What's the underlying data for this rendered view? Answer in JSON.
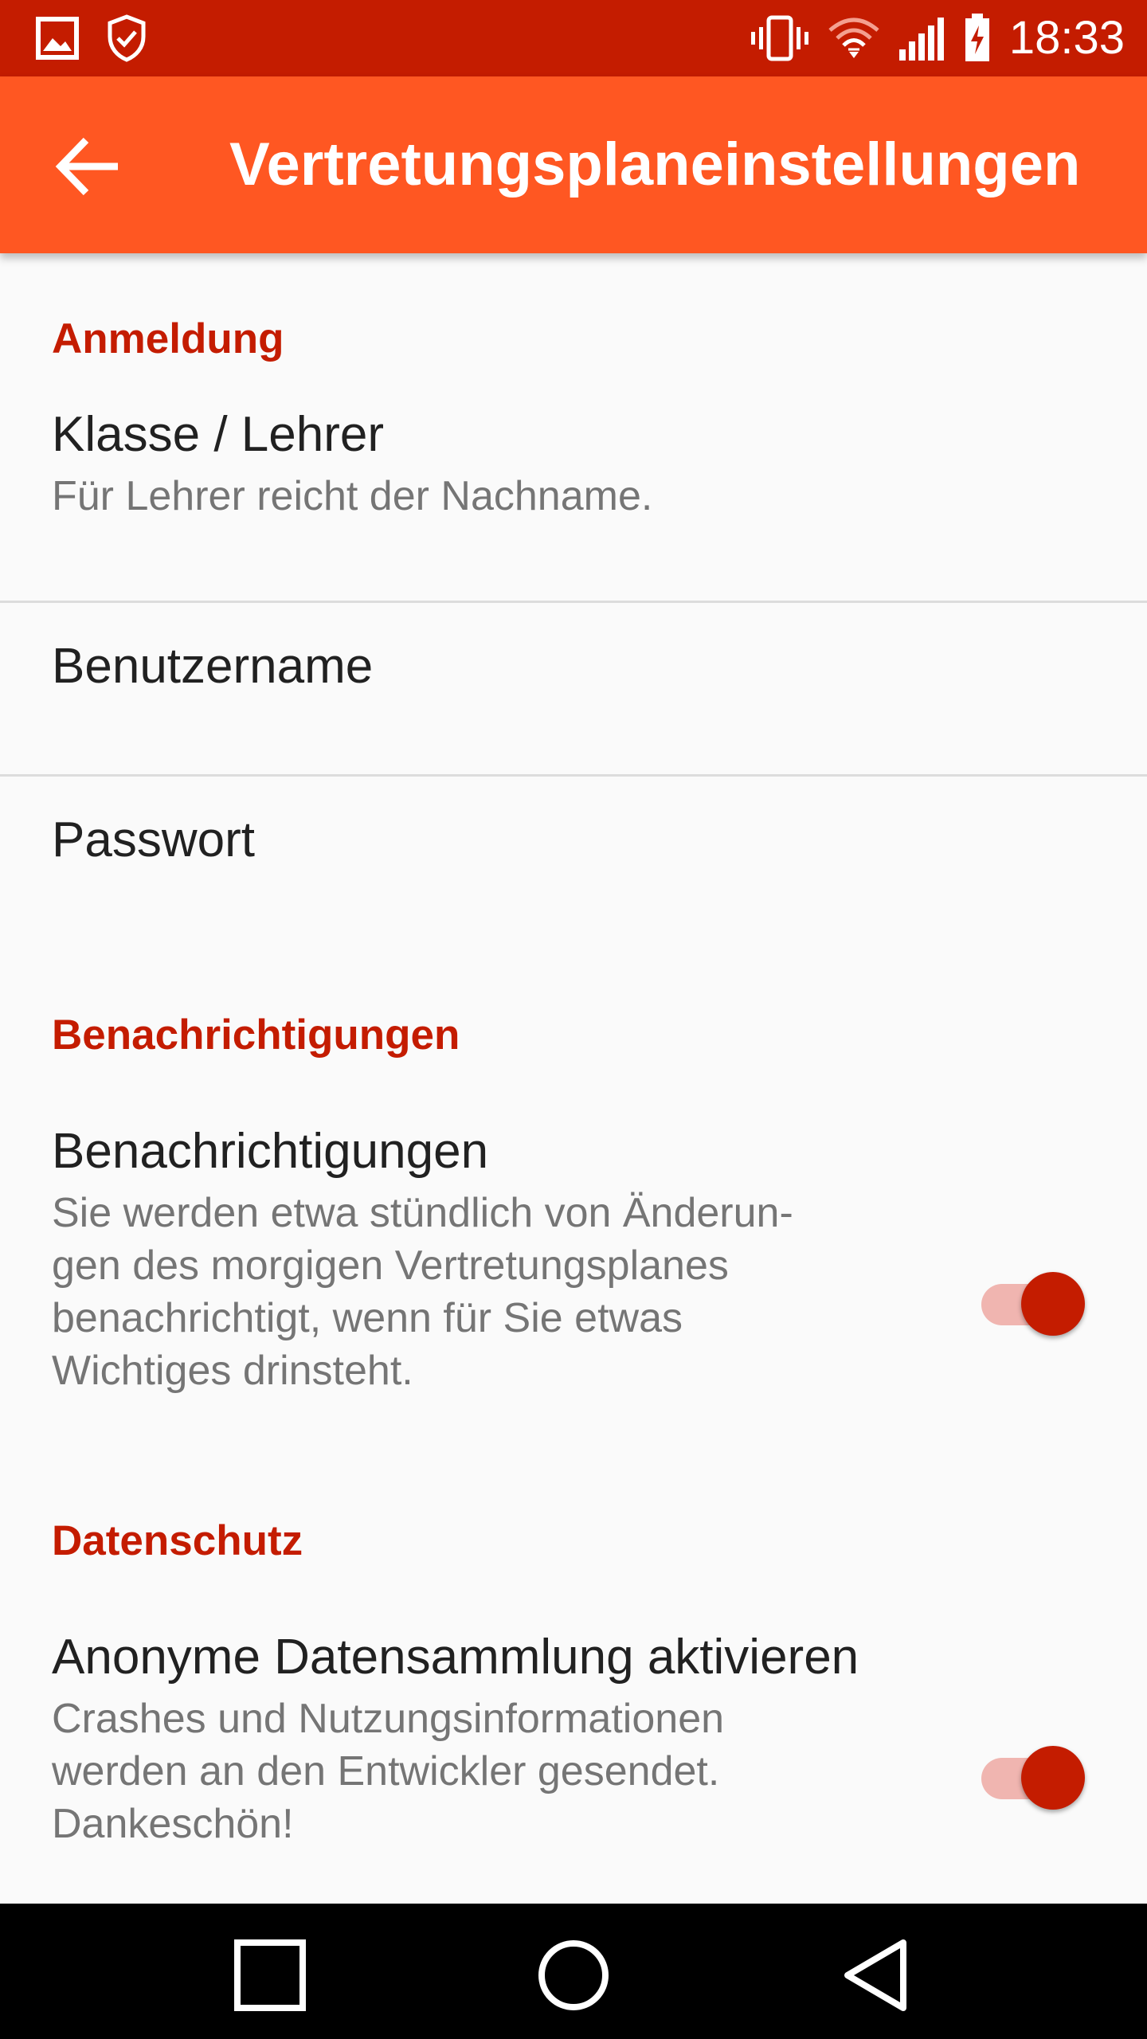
{
  "status_bar": {
    "time": "18:33",
    "icons_left": [
      "image-icon",
      "shield-check-icon"
    ],
    "icons_right": [
      "vibrate-icon",
      "wifi-icon",
      "signal-icon",
      "battery-charging-icon"
    ],
    "background": "#c41c00"
  },
  "app_bar": {
    "title": "Vertretungsplaneinstellungen",
    "back_icon": "arrow-back-icon",
    "background": "#ff5722"
  },
  "sections": {
    "login": {
      "header": "Anmeldung",
      "class_teacher": {
        "title": "Klasse / Lehrer",
        "summary": "Für Lehrer reicht der Nachname."
      },
      "username": {
        "title": "Benutzername"
      },
      "password": {
        "title": "Passwort"
      }
    },
    "notifications": {
      "header": "Benachrichtigungen",
      "notifications_pref": {
        "title": "Benachrichtigungen",
        "summary": "Sie werden etwa stündlich von Änderun-gen des morgigen Vertretungsplanes benachrichtigt, wenn für Sie etwas Wichtiges drinsteht.",
        "enabled": true
      }
    },
    "privacy": {
      "header": "Datenschutz",
      "analytics_pref": {
        "title": "Anonyme Datensammlung aktivieren",
        "summary": "Crashes und Nutzungsinformationen werden an den Entwickler gesendet. Dankeschön!",
        "enabled": true
      }
    }
  },
  "colors": {
    "accent": "#c41c00",
    "switch_track": "#f0b5b0",
    "text_primary": "#212121",
    "text_secondary": "#757575"
  },
  "nav_bar": {
    "recents_icon": "square-icon",
    "home_icon": "circle-icon",
    "back_icon": "triangle-back-icon"
  }
}
